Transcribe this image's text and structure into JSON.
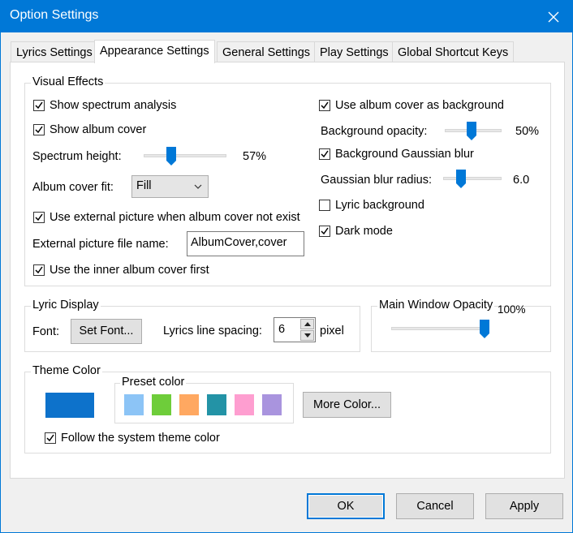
{
  "window": {
    "title": "Option Settings",
    "close_icon": "close-icon"
  },
  "tabs": [
    {
      "label": "Lyrics Settings",
      "active": false
    },
    {
      "label": "Appearance Settings",
      "active": true
    },
    {
      "label": "General Settings",
      "active": false
    },
    {
      "label": "Play Settings",
      "active": false
    },
    {
      "label": "Global Shortcut Keys",
      "active": false
    }
  ],
  "visual_effects": {
    "title": "Visual Effects",
    "show_spectrum": {
      "label": "Show spectrum analysis",
      "checked": true
    },
    "show_album_cover": {
      "label": "Show album cover",
      "checked": true
    },
    "spectrum_height": {
      "label": "Spectrum height:",
      "value_text": "57%",
      "fraction": 0.57
    },
    "album_cover_fit": {
      "label": "Album cover fit:",
      "selected": "Fill"
    },
    "use_external_picture": {
      "label": "Use external picture when album cover not exist",
      "checked": true
    },
    "external_file_name": {
      "label": "External picture file name:",
      "value": "AlbumCover,cover"
    },
    "inner_cover_first": {
      "label": "Use the inner album cover first",
      "checked": true
    },
    "cover_as_background": {
      "label": "Use album cover as background",
      "checked": true
    },
    "background_opacity": {
      "label": "Background opacity:",
      "value_text": "50%",
      "fraction": 0.5
    },
    "gaussian_blur": {
      "label": "Background Gaussian blur",
      "checked": true
    },
    "blur_radius": {
      "label": "Gaussian blur radius:",
      "value_text": "6.0",
      "fraction": 0.3
    },
    "lyric_background": {
      "label": "Lyric background",
      "checked": false
    },
    "dark_mode": {
      "label": "Dark mode",
      "checked": true
    }
  },
  "lyric_display": {
    "title": "Lyric Display",
    "font_label": "Font:",
    "set_font_button": "Set Font...",
    "spacing_label": "Lyrics line spacing:",
    "spacing_value": "6",
    "unit": "pixel"
  },
  "main_window_opacity": {
    "title": "Main Window Opacity",
    "value_text": "100%",
    "fraction": 1.0
  },
  "theme_color": {
    "title": "Theme Color",
    "current_color": "#0d72cb",
    "preset_title": "Preset color",
    "presets": [
      "#8cc4f6",
      "#6ecd3a",
      "#ffa861",
      "#2393a6",
      "#fe9ed0",
      "#a994de"
    ],
    "more_color_button": "More Color...",
    "follow_system": {
      "label": "Follow the system theme color",
      "checked": true
    }
  },
  "footer": {
    "ok": "OK",
    "cancel": "Cancel",
    "apply": "Apply"
  },
  "colors": {
    "accent": "#0078d7",
    "thumb": "#0078d7"
  }
}
